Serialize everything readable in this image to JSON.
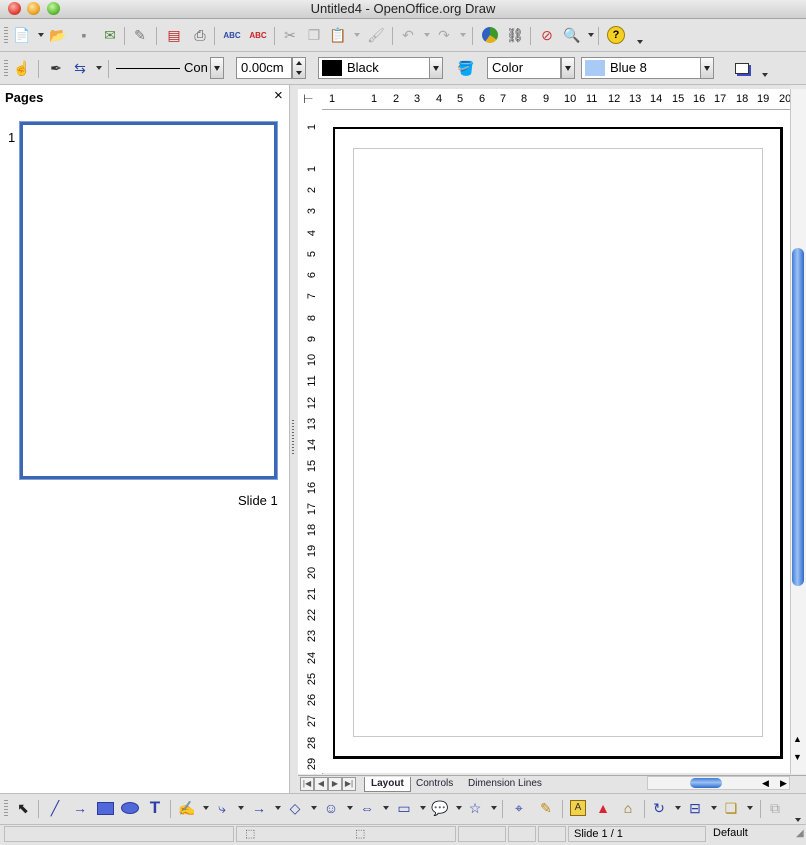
{
  "window": {
    "title": "Untitled4 - OpenOffice.org Draw"
  },
  "line_toolbar": {
    "line_style": "Con",
    "line_width": "0.00cm",
    "line_color": "Black",
    "line_color_hex": "#000000",
    "area_style": "Color",
    "area_color": "Blue 8",
    "area_color_hex": "#a8caf4"
  },
  "pages_panel": {
    "title": "Pages",
    "close_glyph": "×",
    "page_number": "1",
    "slide_label": "Slide 1"
  },
  "rulers": {
    "horizontal": [
      "1",
      "1",
      "2",
      "3",
      "4",
      "5",
      "6",
      "7",
      "8",
      "9",
      "10",
      "11",
      "12",
      "13",
      "14",
      "15",
      "16",
      "17",
      "18",
      "19",
      "20"
    ],
    "vertical": [
      "1",
      "1",
      "2",
      "3",
      "4",
      "5",
      "6",
      "7",
      "8",
      "9",
      "10",
      "11",
      "12",
      "13",
      "14",
      "15",
      "16",
      "17",
      "18",
      "19",
      "20",
      "21",
      "22",
      "23",
      "24",
      "25",
      "26",
      "27",
      "28",
      "29"
    ]
  },
  "tabs": [
    {
      "label": "Layout",
      "active": true
    },
    {
      "label": "Controls",
      "active": false
    },
    {
      "label": "Dimension Lines",
      "active": false
    }
  ],
  "status_bar": {
    "page": "Slide 1 / 1",
    "style": "Default"
  }
}
